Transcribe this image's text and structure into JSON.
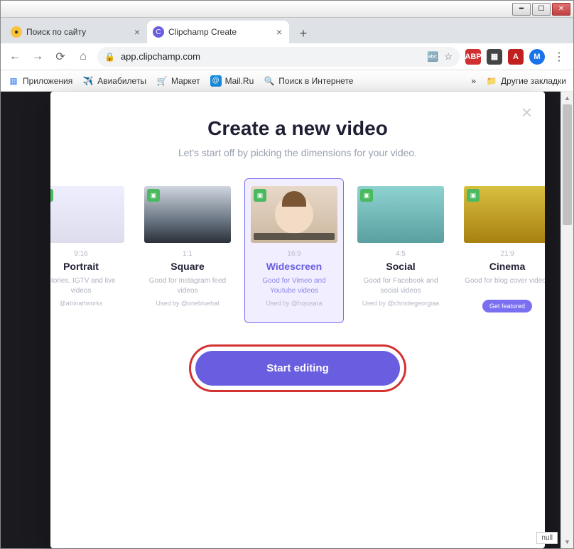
{
  "window": {
    "null_tag": "null"
  },
  "tabs": [
    {
      "title": "Поиск по сайту",
      "active": false
    },
    {
      "title": "Clipchamp Create",
      "active": true
    }
  ],
  "url": {
    "lock": "🔒",
    "domain": "app.clipchamp.com"
  },
  "bookmarks": {
    "apps": "Приложения",
    "items": [
      "Авиабилеты",
      "Маркет",
      "Mail.Ru",
      "Поиск в Интернете"
    ],
    "more": "»",
    "other": "Другие закладки"
  },
  "modal": {
    "title": "Create a new video",
    "subtitle": "Let's start off by picking the dimensions for your video.",
    "start": "Start editing"
  },
  "cards": [
    {
      "ratio": "9:16",
      "name": "Portrait",
      "desc": "Stories, IGTV and live videos",
      "used": "@atrinartworks",
      "selected": false
    },
    {
      "ratio": "1:1",
      "name": "Square",
      "desc": "Good for Instagram feed videos",
      "used": "Used by @onebluehat",
      "selected": false
    },
    {
      "ratio": "16:9",
      "name": "Widescreen",
      "desc": "Good for Vimeo and Youtube videos",
      "used": "Used by @hojusara",
      "selected": true
    },
    {
      "ratio": "4:5",
      "name": "Social",
      "desc": "Good for Facebook and social videos",
      "used": "Used by @christiegeorgiaa",
      "selected": false
    },
    {
      "ratio": "21:9",
      "name": "Cinema",
      "desc": "Good for blog cover videos",
      "feat": "Get featured",
      "selected": false
    }
  ]
}
